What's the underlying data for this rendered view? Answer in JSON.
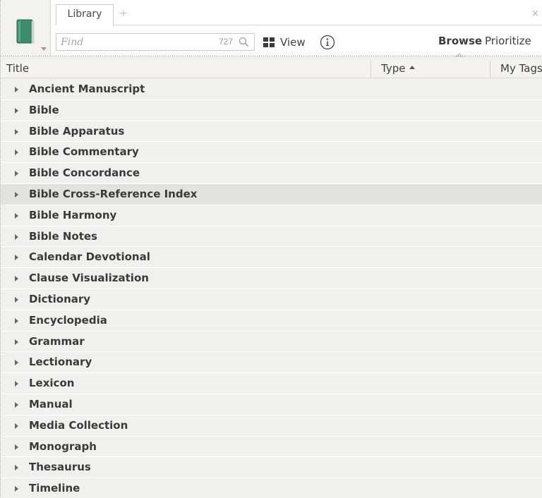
{
  "toolbar": {
    "tab_label": "Library",
    "tab_add": "+",
    "tab_close": "×",
    "find_placeholder": "Find",
    "result_count": "727",
    "view_label": "View",
    "browse_label": "Browse",
    "prioritize_label": "Prioritize"
  },
  "columns": {
    "title": "Title",
    "type": "Type",
    "my_tags": "My Tags"
  },
  "colors": {
    "book_green": "#3c8c6e",
    "panel_bg": "#f1f0ec",
    "row_highlight": "#e3e2dd"
  },
  "rows": [
    {
      "label": "Ancient Manuscript"
    },
    {
      "label": "Bible"
    },
    {
      "label": "Bible Apparatus"
    },
    {
      "label": "Bible Commentary"
    },
    {
      "label": "Bible Concordance"
    },
    {
      "label": "Bible Cross-Reference Index"
    },
    {
      "label": "Bible Harmony"
    },
    {
      "label": "Bible Notes"
    },
    {
      "label": "Calendar Devotional"
    },
    {
      "label": "Clause Visualization"
    },
    {
      "label": "Dictionary"
    },
    {
      "label": "Encyclopedia"
    },
    {
      "label": "Grammar"
    },
    {
      "label": "Lectionary"
    },
    {
      "label": "Lexicon"
    },
    {
      "label": "Manual"
    },
    {
      "label": "Media Collection"
    },
    {
      "label": "Monograph"
    },
    {
      "label": "Thesaurus"
    },
    {
      "label": "Timeline"
    }
  ],
  "highlighted_row": "Bible Cross-Reference Index"
}
